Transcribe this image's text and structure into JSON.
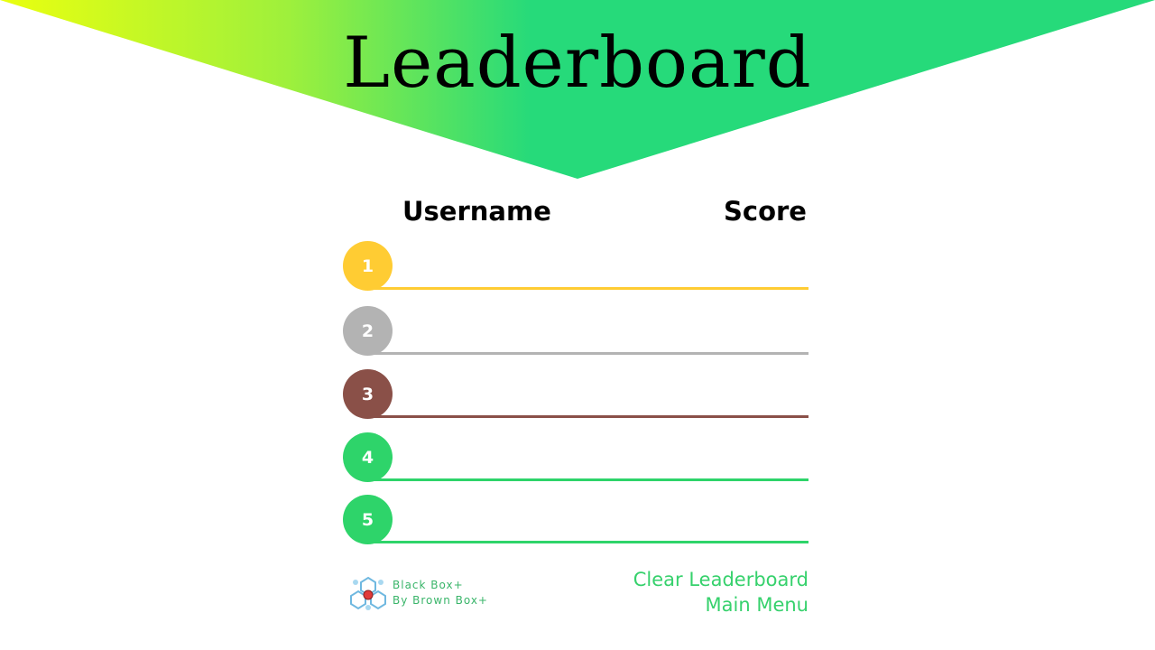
{
  "title": "Leaderboard",
  "columns": {
    "username": "Username",
    "score": "Score"
  },
  "rows": [
    {
      "rank": "1",
      "username": "",
      "score": "",
      "color": "#ffcc33"
    },
    {
      "rank": "2",
      "username": "",
      "score": "",
      "color": "#b3b3b3"
    },
    {
      "rank": "3",
      "username": "",
      "score": "",
      "color": "#8a5048"
    },
    {
      "rank": "4",
      "username": "",
      "score": "",
      "color": "#2ed46a"
    },
    {
      "rank": "5",
      "username": "",
      "score": "",
      "color": "#2ed46a"
    }
  ],
  "footer": {
    "brand_line1": "Black Box+",
    "brand_line2": "By Brown Box+",
    "clear_label": "Clear Leaderboard",
    "main_menu_label": "Main Menu"
  },
  "colors": {
    "banner_gradient_start": "#e8ff10",
    "banner_gradient_end": "#26da7a",
    "link": "#36d16c"
  }
}
